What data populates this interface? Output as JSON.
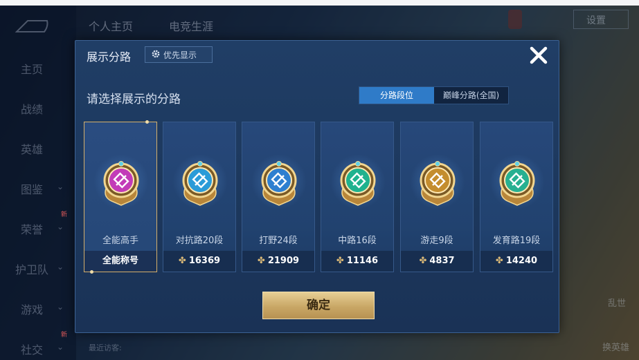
{
  "background": {
    "nav": [
      "个人主页",
      "电竞生涯"
    ],
    "sidebar": [
      {
        "label": "主页",
        "chevron": false,
        "new": false
      },
      {
        "label": "战绩",
        "chevron": false,
        "new": false
      },
      {
        "label": "英雄",
        "chevron": false,
        "new": false
      },
      {
        "label": "图鉴",
        "chevron": true,
        "new": false
      },
      {
        "label": "荣誉",
        "chevron": true,
        "new": true
      },
      {
        "label": "护卫队",
        "chevron": true,
        "new": false
      },
      {
        "label": "游戏",
        "chevron": true,
        "new": false
      },
      {
        "label": "社交",
        "chevron": true,
        "new": true
      }
    ],
    "new_tag": "新",
    "settings_label": "设置",
    "side_right": [
      "乱世",
      "换英雄"
    ],
    "recent_label": "最近访客:"
  },
  "dialog": {
    "title": "展示分路",
    "priority_label": "优先显示",
    "subtitle": "请选择展示的分路",
    "tabs": [
      {
        "label": "分路段位",
        "active": true
      },
      {
        "label": "巅峰分路(全国)",
        "active": false
      }
    ],
    "cards": [
      {
        "label": "全能高手",
        "bottom": "全能称号",
        "has_points": false,
        "selected": true,
        "icon": "all-rounder-badge-icon",
        "color": "#c23bb8"
      },
      {
        "label": "对抗路20段",
        "bottom": "16369",
        "has_points": true,
        "selected": false,
        "icon": "clash-lane-badge-icon",
        "color": "#2a9bd8"
      },
      {
        "label": "打野24段",
        "bottom": "21909",
        "has_points": true,
        "selected": false,
        "icon": "jungle-badge-icon",
        "color": "#2e7fd0"
      },
      {
        "label": "中路16段",
        "bottom": "11146",
        "has_points": true,
        "selected": false,
        "icon": "mid-lane-badge-icon",
        "color": "#1fb28e"
      },
      {
        "label": "游走9段",
        "bottom": "4837",
        "has_points": true,
        "selected": false,
        "icon": "roam-badge-icon",
        "color": "#c48d2e"
      },
      {
        "label": "发育路19段",
        "bottom": "14240",
        "has_points": true,
        "selected": false,
        "icon": "farm-lane-badge-icon",
        "color": "#27b091"
      }
    ],
    "confirm_label": "确定"
  },
  "colors": {
    "dialog_bg": "#203e66",
    "accent_tab": "#2f7bc8",
    "gold": "#d6b06a",
    "points_icon": "#d9b877"
  }
}
